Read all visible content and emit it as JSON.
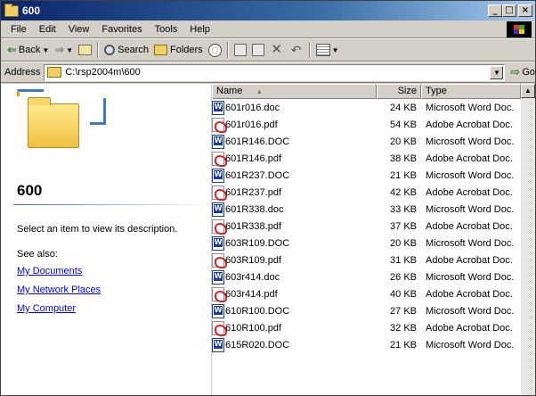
{
  "window": {
    "title": "600"
  },
  "menu": [
    "File",
    "Edit",
    "View",
    "Favorites",
    "Tools",
    "Help"
  ],
  "toolbar": {
    "back_label": "Back",
    "search_label": "Search",
    "folders_label": "Folders"
  },
  "address": {
    "label": "Address",
    "value": "C:\\rsp2004m\\600",
    "go_label": "Go"
  },
  "left_pane": {
    "folder_name": "600",
    "description": "Select an item to view its description.",
    "see_also": "See also:",
    "links": [
      "My Documents",
      "My Network Places",
      "My Computer"
    ]
  },
  "columns": {
    "name": "Name",
    "size": "Size",
    "type": "Type"
  },
  "files": [
    {
      "name": "601r016.doc",
      "size": "24 KB",
      "type": "Microsoft Word Doc.",
      "icon": "word-icon"
    },
    {
      "name": "601r016.pdf",
      "size": "54 KB",
      "type": "Adobe Acrobat Doc.",
      "icon": "pdf-icon"
    },
    {
      "name": "601R146.DOC",
      "size": "20 KB",
      "type": "Microsoft Word Doc.",
      "icon": "word-icon"
    },
    {
      "name": "601R146.pdf",
      "size": "38 KB",
      "type": "Adobe Acrobat Doc.",
      "icon": "pdf-icon"
    },
    {
      "name": "601R237.DOC",
      "size": "21 KB",
      "type": "Microsoft Word Doc.",
      "icon": "word-icon"
    },
    {
      "name": "601R237.pdf",
      "size": "42 KB",
      "type": "Adobe Acrobat Doc.",
      "icon": "pdf-icon"
    },
    {
      "name": "601R338.doc",
      "size": "33 KB",
      "type": "Microsoft Word Doc.",
      "icon": "word-icon"
    },
    {
      "name": "601R338.pdf",
      "size": "37 KB",
      "type": "Adobe Acrobat Doc.",
      "icon": "pdf-icon"
    },
    {
      "name": "603R109.DOC",
      "size": "20 KB",
      "type": "Microsoft Word Doc.",
      "icon": "word-icon"
    },
    {
      "name": "603R109.pdf",
      "size": "31 KB",
      "type": "Adobe Acrobat Doc.",
      "icon": "pdf-icon"
    },
    {
      "name": "603r414.doc",
      "size": "26 KB",
      "type": "Microsoft Word Doc.",
      "icon": "word-icon"
    },
    {
      "name": "603r414.pdf",
      "size": "40 KB",
      "type": "Adobe Acrobat Doc.",
      "icon": "pdf-icon"
    },
    {
      "name": "610R100.DOC",
      "size": "27 KB",
      "type": "Microsoft Word Doc.",
      "icon": "word-icon"
    },
    {
      "name": "610R100.pdf",
      "size": "32 KB",
      "type": "Adobe Acrobat Doc.",
      "icon": "pdf-icon"
    },
    {
      "name": "615R020.DOC",
      "size": "21 KB",
      "type": "Microsoft Word Doc.",
      "icon": "word-icon"
    }
  ]
}
